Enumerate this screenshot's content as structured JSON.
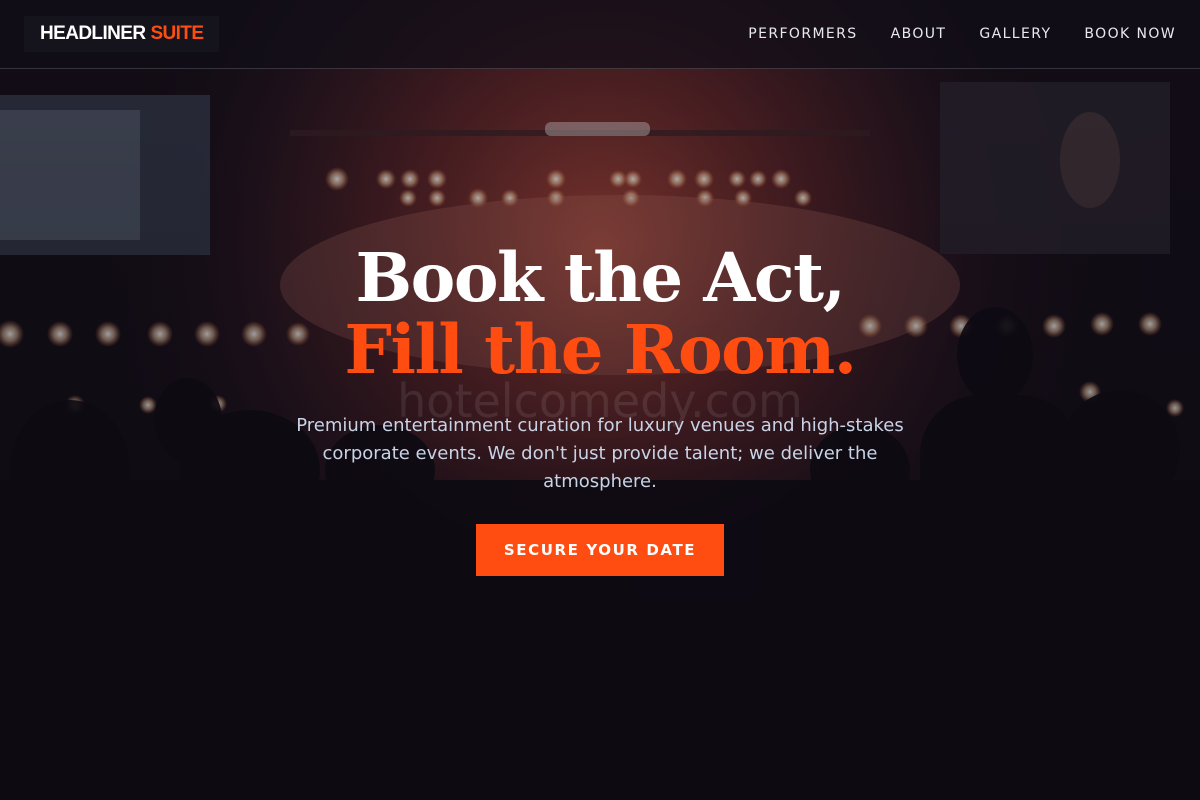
{
  "brand": {
    "name_main": "HEADLINER",
    "name_accent": "SUITE",
    "accent_color": "#ff4d12"
  },
  "nav": {
    "links": [
      {
        "label": "PERFORMERS"
      },
      {
        "label": "ABOUT"
      },
      {
        "label": "GALLERY"
      },
      {
        "label": "BOOK NOW"
      }
    ]
  },
  "hero": {
    "headline_line1": "Book the Act,",
    "headline_line2": "Fill the Room.",
    "subtitle": "Premium entertainment curation for luxury venues and high-stakes corporate events. We don't just provide talent; we deliver the atmosphere.",
    "cta_label": "SECURE YOUR DATE",
    "background": "concert-crowd-photo"
  },
  "watermark": "hotelcomedy.com"
}
